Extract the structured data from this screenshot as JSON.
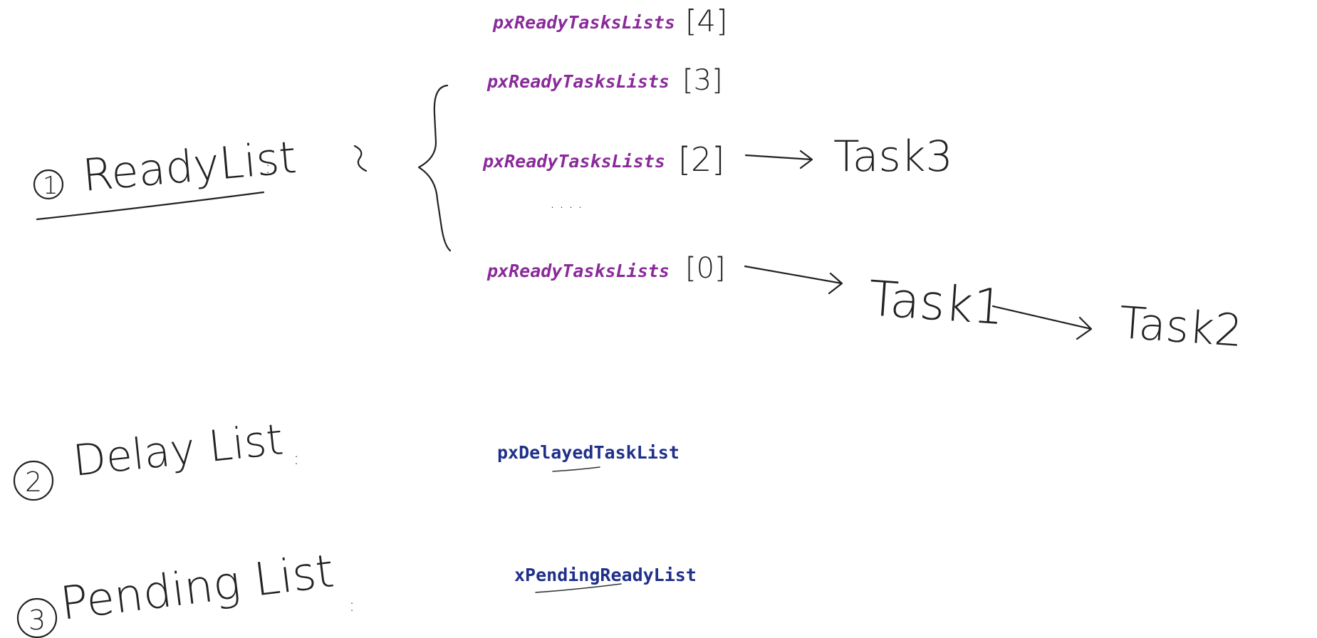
{
  "sections": {
    "ready": {
      "number": "1",
      "label": "ReadyList",
      "separator": ":"
    },
    "delay": {
      "number": "2",
      "label": "Delay List",
      "separator": ":"
    },
    "pending": {
      "number": "3",
      "label": "Pending List",
      "separator": ":"
    }
  },
  "ready_lists": {
    "name": "pxReadyTasksLists",
    "entries": [
      {
        "index": "[4]"
      },
      {
        "index": "[3]"
      },
      {
        "index": "[2]",
        "tasks": [
          "Task3"
        ]
      },
      {
        "index": "[0]",
        "tasks": [
          "Task1",
          "Task2"
        ]
      }
    ],
    "ellipsis": "....",
    "code_color": "#8a2a9a"
  },
  "delayed_list": {
    "name": "pxDelayedTaskList",
    "code_color": "#1f2f8a"
  },
  "pending_list": {
    "name": "xPendingReadyList",
    "code_color": "#1f2f8a"
  },
  "ink_color": "#222222"
}
